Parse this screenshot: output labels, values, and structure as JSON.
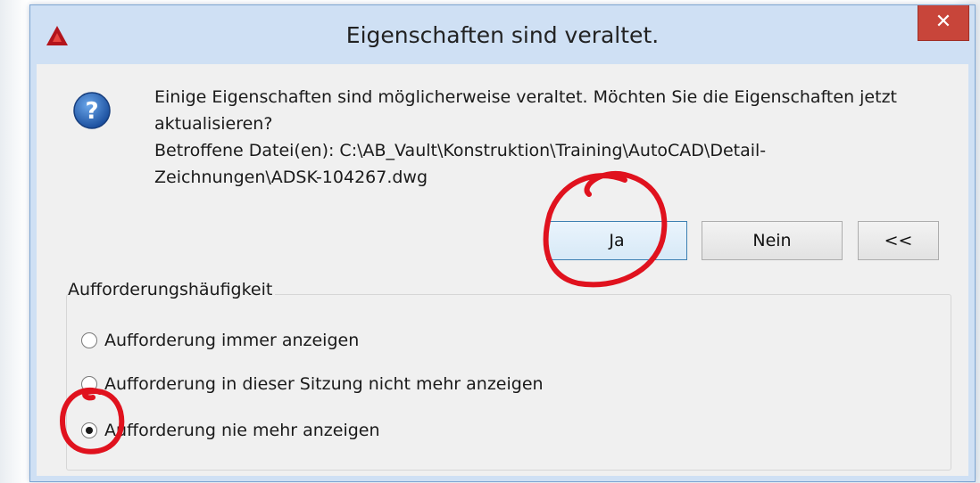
{
  "window": {
    "title": "Eigenschaften sind veraltet.",
    "close_glyph": "✕"
  },
  "message": {
    "lines": [
      "Einige Eigenschaften sind möglicherweise veraltet. Möchten Sie die Eigenschaften jetzt",
      "aktualisieren?",
      "Betroffene Datei(en): C:\\AB_Vault\\Konstruktion\\Training\\AutoCAD\\Detail-",
      "Zeichnungen\\ADSK-104267.dwg"
    ]
  },
  "buttons": {
    "yes": "Ja",
    "no": "Nein",
    "collapse": "<<"
  },
  "prompt_frequency": {
    "legend": "Aufforderungshäufigkeit",
    "options": [
      {
        "label": "Aufforderung immer anzeigen",
        "selected": false
      },
      {
        "label": "Aufforderung in dieser Sitzung nicht mehr anzeigen",
        "selected": false
      },
      {
        "label": "Aufforderung nie mehr anzeigen",
        "selected": true
      }
    ]
  },
  "icons": {
    "app": "autocad-icon",
    "message": "question-icon",
    "close": "close-icon"
  },
  "colors": {
    "title_bar": "#cfe0f4",
    "close_button": "#c8453a",
    "dialog_body": "#f0f0f0",
    "annotation": "#e0121e"
  }
}
